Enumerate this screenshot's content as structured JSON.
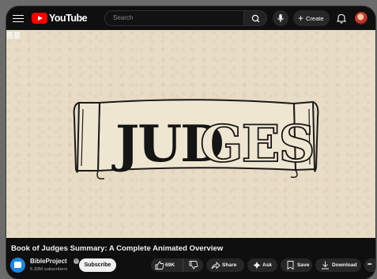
{
  "app": {
    "logo_text": "YouTube"
  },
  "search": {
    "placeholder": "Search"
  },
  "header": {
    "create_label": "Create"
  },
  "video": {
    "title": "Book of Judges Summary: A Complete Animated Overview",
    "banner_text_dark": "JUD",
    "banner_text_light": "GES"
  },
  "channel": {
    "name": "BibleProject",
    "verified_mark": "✓",
    "subscribers": "5.33M subscribers",
    "subscribe_label": "Subscribe"
  },
  "actions": {
    "like_count": "69K",
    "share_label": "Share",
    "ask_label": "Ask",
    "save_label": "Save",
    "download_label": "Download",
    "more_label": "•••"
  },
  "icons": {
    "menu": "menu-icon",
    "search": "search-icon",
    "mic": "mic-icon",
    "bell": "bell-icon",
    "like": "thumbs-up-icon",
    "dislike": "thumbs-down-icon",
    "share": "share-icon",
    "ask": "sparkle-icon",
    "save": "bookmark-icon",
    "download": "download-icon"
  },
  "colors": {
    "brand_red": "#ff0000",
    "background": "#0f0f0f",
    "pill": "#272727",
    "channel_blue": "#1c87e6"
  }
}
